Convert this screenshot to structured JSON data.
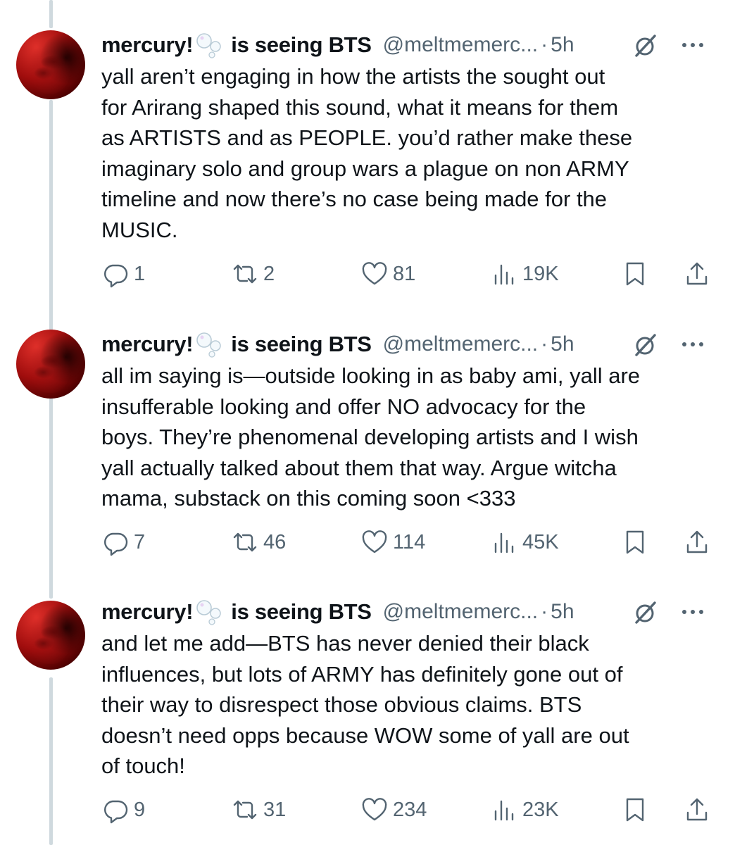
{
  "tweets": [
    {
      "display_name": "mercury!",
      "name_suffix": "is seeing BTS",
      "handle": "@meltmemerc...",
      "separator": "·",
      "time": "5h",
      "text_lines": [
        "yall aren’t engaging in how the artists the sought out",
        "for Arirang shaped this sound, what it means for them",
        "as ARTISTS and as PEOPLE. you’d rather make these",
        "imaginary solo and group wars a plague on non ARMY",
        "timeline and now there’s no case being made for the",
        "MUSIC."
      ],
      "replies": "1",
      "reposts": "2",
      "likes": "81",
      "views": "19K"
    },
    {
      "display_name": "mercury!",
      "name_suffix": "is seeing BTS",
      "handle": "@meltmemerc...",
      "separator": "·",
      "time": "5h",
      "text_lines": [
        "all im saying is—outside looking in as baby ami, yall are",
        "insufferable looking and offer NO advocacy for the",
        "boys. They’re phenomenal developing artists and I wish",
        "yall actually talked about them that way. Argue witcha",
        "mama, substack on this coming soon <333"
      ],
      "replies": "7",
      "reposts": "46",
      "likes": "114",
      "views": "45K"
    },
    {
      "display_name": "mercury!",
      "name_suffix": "is seeing BTS",
      "handle": "@meltmemerc...",
      "separator": "·",
      "time": "5h",
      "text_lines": [
        "and let me add—BTS has never denied their black",
        "influences, but lots of ARMY has definitely gone out of",
        "their way to disrespect those obvious claims. BTS",
        "doesn’t need opps because WOW some of yall are out",
        "of touch!"
      ],
      "replies": "9",
      "reposts": "31",
      "likes": "234",
      "views": "23K"
    }
  ],
  "icons": {
    "reply": "reply-bubble-icon",
    "repost": "repost-arrows-icon",
    "like": "heart-icon",
    "views": "views-bar-chart-icon",
    "bookmark": "bookmark-icon",
    "share": "share-upload-icon",
    "grok": "grok-slash-circle-icon",
    "more": "more-dots-icon",
    "emoji": "bubbles-emoji-icon"
  },
  "colors": {
    "text": "#0f1419",
    "secondary": "#536471",
    "thread_line": "#cfd9de",
    "background": "#ffffff"
  }
}
